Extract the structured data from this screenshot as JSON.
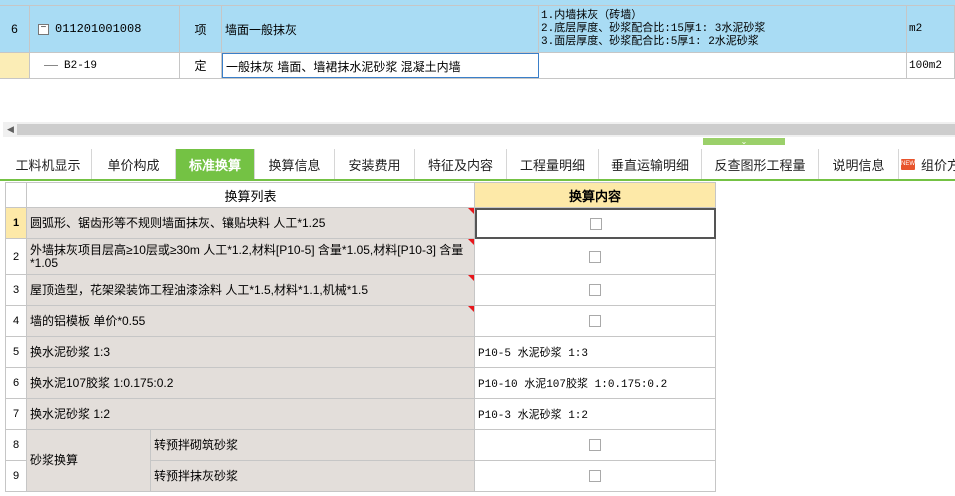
{
  "top_grid": {
    "row6": {
      "row_num": "6",
      "code": "011201001008",
      "type": "项",
      "name": "墙面一般抹灰",
      "features": [
        "1.内墙抹灰（砖墙）",
        "2.底层厚度、砂浆配合比:15厚1: 3水泥砂浆",
        "3.面层厚度、砂浆配合比:5厚1: 2水泥砂浆"
      ],
      "unit": "m2"
    },
    "row_sub": {
      "code": "B2-19",
      "type": "定",
      "name": "一般抹灰 墙面、墙裙抹水泥砂浆 混凝土内墙",
      "unit": "100m2"
    }
  },
  "tabs": [
    {
      "label": "工料机显示"
    },
    {
      "label": "单价构成"
    },
    {
      "label": "标准换算",
      "active": true
    },
    {
      "label": "换算信息"
    },
    {
      "label": "安装费用"
    },
    {
      "label": "特征及内容"
    },
    {
      "label": "工程量明细"
    },
    {
      "label": "垂直运输明细"
    },
    {
      "label": "反查图形工程量"
    },
    {
      "label": "说明信息"
    },
    {
      "label": "组价方",
      "badge": "NEW"
    }
  ],
  "conversion": {
    "header_list": "换算列表",
    "header_content": "换算内容",
    "rows": [
      {
        "num": "1",
        "desc": "圆弧形、锯齿形等不规则墙面抹灰、镶贴块料 人工*1.25",
        "content": "",
        "checkbox": true,
        "flag": true
      },
      {
        "num": "2",
        "desc": "外墙抹灰项目层高≥10层或≥30m 人工*1.2,材料[P10-5] 含量*1.05,材料[P10-3] 含量*1.05",
        "content": "",
        "checkbox": true,
        "flag": true
      },
      {
        "num": "3",
        "desc": "屋顶造型，花架梁装饰工程油漆涂料 人工*1.5,材料*1.1,机械*1.5",
        "content": "",
        "checkbox": true,
        "flag": true
      },
      {
        "num": "4",
        "desc": "墙的铝模板 单价*0.55",
        "content": "",
        "checkbox": true,
        "flag": true
      },
      {
        "num": "5",
        "desc": "换水泥砂浆 1:3",
        "content": "P10-5  水泥砂浆 1:3",
        "checkbox": false,
        "flag": false
      },
      {
        "num": "6",
        "desc": "换水泥107胶浆 1:0.175:0.2",
        "content": "P10-10  水泥107胶浆 1:0.175:0.2",
        "checkbox": false,
        "flag": false
      },
      {
        "num": "7",
        "desc": "换水泥砂浆 1:2",
        "content": "P10-3  水泥砂浆 1:2",
        "checkbox": false,
        "flag": false
      },
      {
        "num": "8",
        "group": "砂浆换算",
        "desc": "转预拌砌筑砂浆",
        "content": "",
        "checkbox": true,
        "flag": false
      },
      {
        "num": "9",
        "group": "砂浆换算",
        "desc": "转预拌抹灰砂浆",
        "content": "",
        "checkbox": true,
        "flag": false
      }
    ]
  }
}
